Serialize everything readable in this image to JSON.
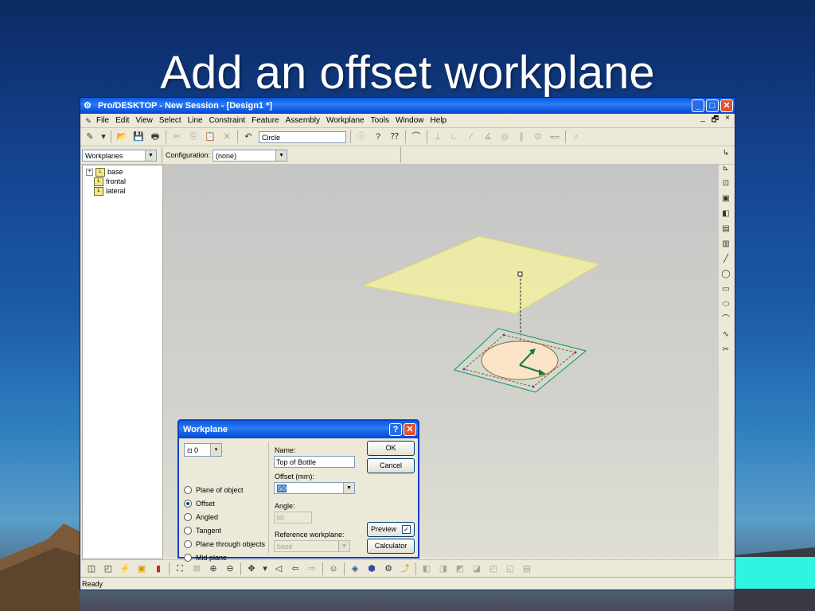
{
  "slide": {
    "title": "Add an offset workplane"
  },
  "window": {
    "title": "Pro/DESKTOP - New Session - [Design1 *]",
    "min_glyph": "_",
    "max_glyph": "□",
    "close_glyph": "✕"
  },
  "menu": {
    "items": [
      "File",
      "Edit",
      "View",
      "Select",
      "Line",
      "Constraint",
      "Feature",
      "Assembly",
      "Workplane",
      "Tools",
      "Window",
      "Help"
    ],
    "right_controls": [
      "_",
      "🗗",
      "×"
    ]
  },
  "toolbar": {
    "command_field": "Circle"
  },
  "combos": {
    "browser_mode": "Workplanes",
    "configuration_label": "Configuration:",
    "configuration_value": "(none)"
  },
  "tree": {
    "items": [
      "base",
      "frontal",
      "lateral"
    ]
  },
  "dialog": {
    "title": "Workplane",
    "help_glyph": "?",
    "close_glyph": "✕",
    "selector_value": "0",
    "options": [
      "Plane of object",
      "Offset",
      "Angled",
      "Tangent",
      "Plane through objects",
      "Mid plane"
    ],
    "selected_option": "Offset",
    "name_label": "Name:",
    "name_value": "Top of Bottle",
    "offset_label": "Offset (mm):",
    "offset_value": "50",
    "angle_label": "Angle:",
    "angle_value": "90",
    "ref_label": "Reference workplane:",
    "ref_value": "base",
    "ok_label": "OK",
    "cancel_label": "Cancel",
    "preview_label": "Preview",
    "preview_checked": true,
    "calculator_label": "Calculator"
  },
  "statusbar": {
    "text": "Ready"
  },
  "colors": {
    "upper_plane": "#f2f0a0",
    "lower_plane": "#cfe2cf",
    "circle_fill": "#fbe3c8",
    "arrow": "#167a3c"
  }
}
